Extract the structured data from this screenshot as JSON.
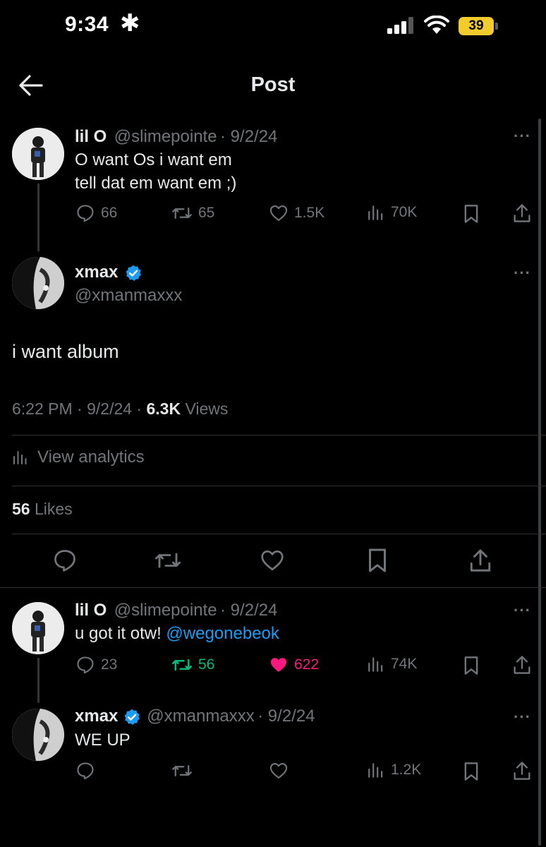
{
  "status_bar": {
    "time": "9:34",
    "battery": "39"
  },
  "header": {
    "title": "Post"
  },
  "parent_tweet": {
    "name": "lil O",
    "handle": "@slimepointe",
    "date": "· 9/2/24",
    "text_line1": "O want Os i want em",
    "text_line2": "tell dat em want em ;)",
    "replies": "66",
    "reposts": "65",
    "likes": "1.5K",
    "views": "70K"
  },
  "main_tweet": {
    "name": "xmax",
    "handle": "@xmanmaxxx",
    "text": "i want album",
    "time": "6:22 PM · 9/2/24 ·",
    "views_count": "6.3K",
    "views_label": "Views",
    "analytics_label": "View analytics",
    "likes_count": "56",
    "likes_label": "Likes"
  },
  "reply_1": {
    "name": "lil O",
    "handle": "@slimepointe",
    "date": "· 9/2/24",
    "text": "u got it otw!",
    "mention": "@wegonebeok",
    "replies": "23",
    "reposts": "56",
    "likes": "622",
    "views": "74K"
  },
  "reply_2": {
    "name": "xmax",
    "handle": "@xmanmaxxx",
    "date": "· 9/2/24",
    "text": "WE UP",
    "views": "1.2K"
  },
  "colors": {
    "background": "#000000",
    "text": "#e7e9ea",
    "muted": "#71767b",
    "accent_blue": "#1d9bf0",
    "repost_green": "#00ba7c",
    "like_pink": "#f91880",
    "battery_yellow": "#f2cc2d"
  }
}
